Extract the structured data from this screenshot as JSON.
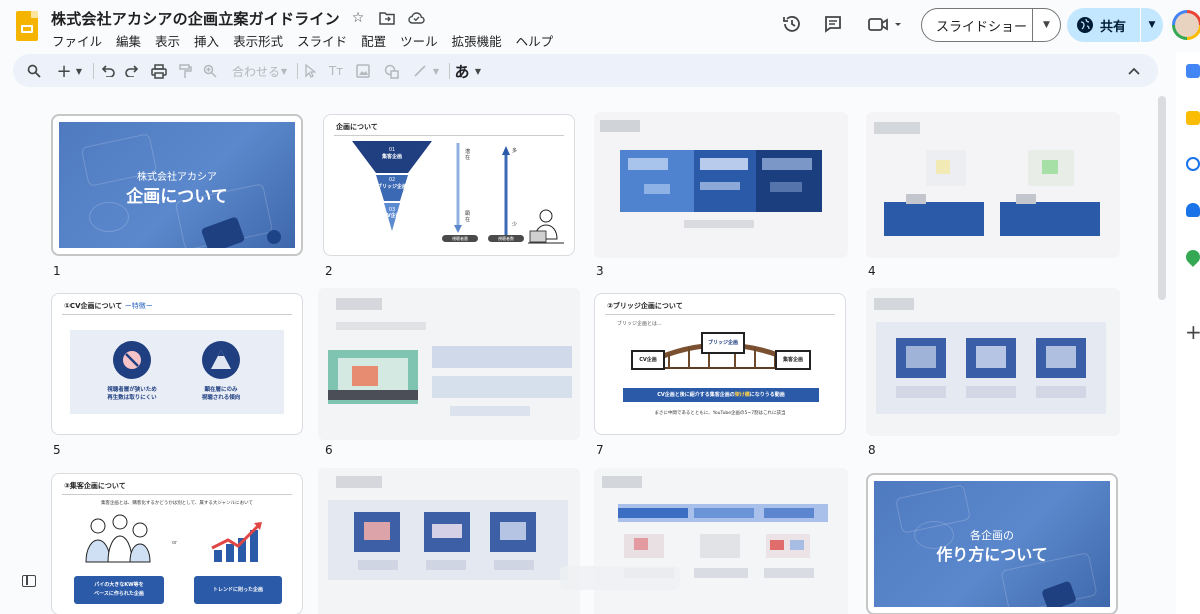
{
  "doc": {
    "title": "株式会社アカシアの企画立案ガイドライン"
  },
  "menu": [
    "ファイル",
    "編集",
    "表示",
    "挿入",
    "表示形式",
    "スライド",
    "配置",
    "ツール",
    "拡張機能",
    "ヘルプ"
  ],
  "header": {
    "slideshow_label": "スライドショー",
    "share_label": "共有"
  },
  "toolbar": {
    "zoom_label": "合わせる",
    "input_tool": "あ",
    "text_tool": "Tт"
  },
  "slides": [
    {
      "num": "1",
      "sub": "株式会社アカシア",
      "title": "企画について"
    },
    {
      "num": "2",
      "heading": "企画について",
      "funnel": [
        "01",
        "集客企画",
        "02",
        "ブリッジ企画",
        "03",
        "CV企画"
      ],
      "arrow_left_top": "潜在",
      "arrow_left_bottom": "顕在",
      "arrow_right_top": "多",
      "arrow_right_bottom": "少",
      "pill_left": "視聴者層",
      "pill_right": "視聴者数"
    },
    {
      "num": "3"
    },
    {
      "num": "4"
    },
    {
      "num": "5",
      "heading": "①CV企画について",
      "heading_accent": "ー特徴ー",
      "point1_line1": "視聴者層が狭いため",
      "point1_line2": "再生数は取りにくい",
      "point2_line1": "顕在層にのみ",
      "point2_line2": "視聴される傾向"
    },
    {
      "num": "6"
    },
    {
      "num": "7",
      "heading": "②ブリッジ企画について",
      "lead": "ブリッジ企画とは...",
      "left_box": "CV企画",
      "center_box": "ブリッジ企画",
      "right_box": "集客企画",
      "banner_pre": "CV企画と後に紹介する集客企画の",
      "banner_em": "架け橋",
      "banner_post": "になりうる動画",
      "footnote": "まさに中間であるとともに、YouTube企画の5~7割はこれに該当"
    },
    {
      "num": "8"
    },
    {
      "num": "",
      "heading": "③集客企画について",
      "lead": "集客企画とは、購客化するかどうかは別として、属する大ジャンルにおいて",
      "or_text": "or",
      "btn_left_line1": "パイの大きなKW等を",
      "btn_left_line2": "ベースに作られた企画",
      "btn_right": "トレンドに則った企画"
    },
    {
      "num": ""
    },
    {
      "num": ""
    },
    {
      "num": "",
      "sub": "各企画の",
      "title": "作り方について"
    }
  ]
}
